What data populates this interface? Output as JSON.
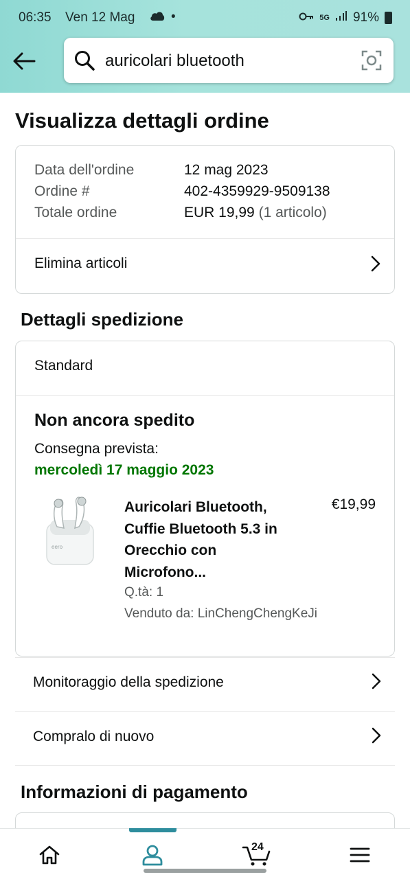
{
  "status_bar": {
    "time": "06:35",
    "date": "Ven 12 Mag",
    "network": "5G",
    "battery": "91%"
  },
  "search": {
    "value": "auricolari bluetooth"
  },
  "page_title": "Visualizza dettagli ordine",
  "order_summary": {
    "date_label": "Data dell'ordine",
    "date_value": "12 mag 2023",
    "number_label": "Ordine #",
    "number_value": "402-4359929-9509138",
    "total_label": "Totale ordine",
    "total_value": "EUR 19,99",
    "total_items": "(1 articolo)",
    "delete_items_label": "Elimina articoli"
  },
  "shipping": {
    "section_title": "Dettagli spedizione",
    "method": "Standard",
    "status": "Non ancora spedito",
    "eta_label": "Consegna prevista:",
    "eta_date": "mercoledì 17 maggio 2023",
    "product": {
      "title": "Auricolari Bluetooth, Cuffie Bluetooth 5.3 in Orecchio con Microfono...",
      "price": "€19,99",
      "quantity": "Q.tà: 1",
      "seller": "Venduto da: LinChengChengKeJi"
    }
  },
  "actions": {
    "track": "Monitoraggio della spedizione",
    "buy_again": "Compralo di nuovo"
  },
  "payment": {
    "section_title": "Informazioni di pagamento"
  },
  "bottom_nav": {
    "cart_count": "24",
    "accent_color": "#2e8d9d"
  },
  "colors": {
    "header_gradient_start": "#8fd9d3",
    "header_gradient_end": "#a9e2dd",
    "delivery_green": "#007600"
  }
}
